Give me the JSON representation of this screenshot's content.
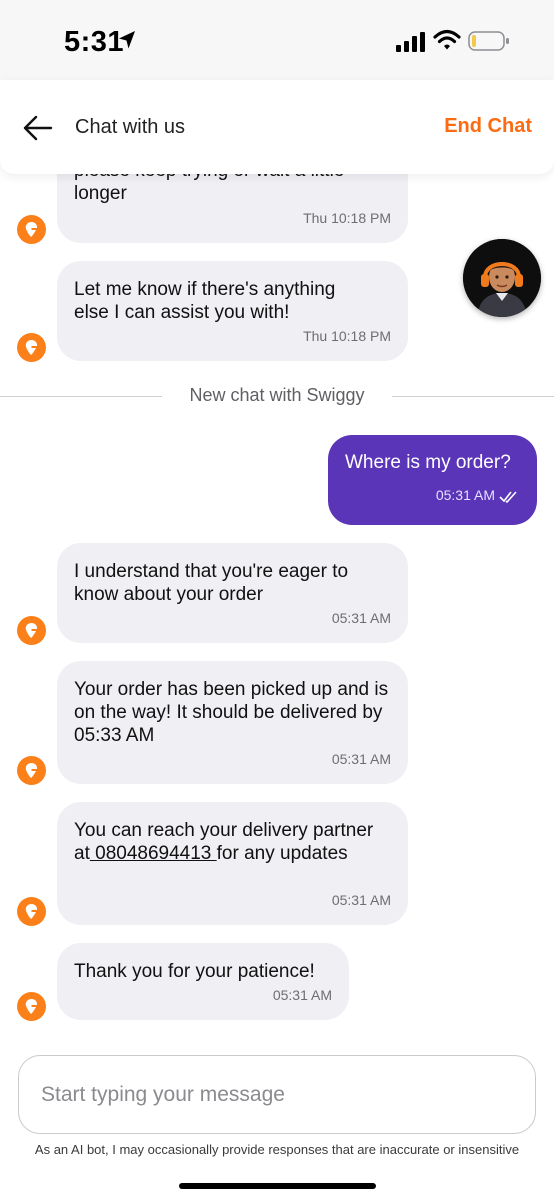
{
  "status_bar": {
    "time": "5:31",
    "icons": [
      "location-arrow-icon",
      "signal-icon",
      "wifi-icon",
      "battery-icon"
    ]
  },
  "header": {
    "title": "Chat with us",
    "end_chat_label": "End Chat",
    "accent_color": "#fc6b12"
  },
  "messages": {
    "m1": {
      "text": "please keep trying or wait a little longer",
      "visible_text": "longer",
      "time": "Thu 10:18 PM"
    },
    "m2": {
      "text": "Let me know if there's anything else I can assist you with!",
      "time": "Thu 10:18 PM"
    },
    "divider": "New chat with Swiggy",
    "user": {
      "text": "Where is my order?",
      "time": "05:31 AM"
    },
    "m3": {
      "text": "I understand that you're eager to know about your order",
      "time": "05:31 AM"
    },
    "m4": {
      "text": "Your order has been picked up and is on the way! It should be delivered by 05:33 AM",
      "time": "05:31 AM"
    },
    "m5": {
      "prefix": "You can reach your delivery partner at",
      "phone": " 08048694413 ",
      "suffix": "for any updates",
      "time": "05:31 AM"
    },
    "m6": {
      "text": "Thank you for your patience!",
      "time": "05:31 AM"
    }
  },
  "input": {
    "placeholder": "Start typing your message"
  },
  "disclaimer": "As an AI bot, I may occasionally provide responses that are inaccurate or insensitive",
  "colors": {
    "user_bubble": "#5a35b8",
    "bot_bubble": "#efeff4",
    "bot_avatar": "#fc8019"
  }
}
